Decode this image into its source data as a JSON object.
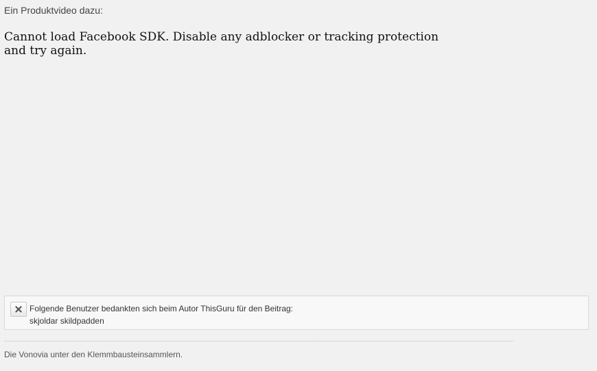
{
  "post": {
    "intro_text": "Ein Produktvideo dazu:",
    "embed_error": "Cannot load Facebook SDK. Disable any adblocker or tracking protection and try again."
  },
  "thanks": {
    "close_icon": "close-icon",
    "message": "Folgende Benutzer bedankten sich beim Autor ThisGuru für den Beitrag:",
    "users": [
      "skjoldar",
      "skildpadden"
    ]
  },
  "signature": {
    "text": "Die Vonovia unter den Klemmbausteinsammlern."
  }
}
